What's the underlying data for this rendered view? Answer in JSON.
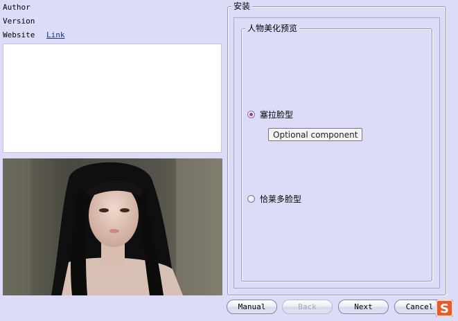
{
  "info": {
    "author_label": "Author",
    "version_label": "Version",
    "website_label": "Website",
    "website_link": "Link"
  },
  "install_group": {
    "title": "安装",
    "preview_group": {
      "title": "人物美化预览",
      "options": [
        {
          "label": "塞拉脸型",
          "checked": true
        },
        {
          "label": "恰莱多脸型",
          "checked": false
        }
      ],
      "tooltip": "Optional component"
    }
  },
  "buttons": {
    "manual": "Manual",
    "back": "Back",
    "next": "Next",
    "cancel": "Cancel"
  },
  "logo_text": "S",
  "colors": {
    "background": "#dcdcf8",
    "radio_checked": "#9a3aa8",
    "logo": "#e85a2a"
  }
}
